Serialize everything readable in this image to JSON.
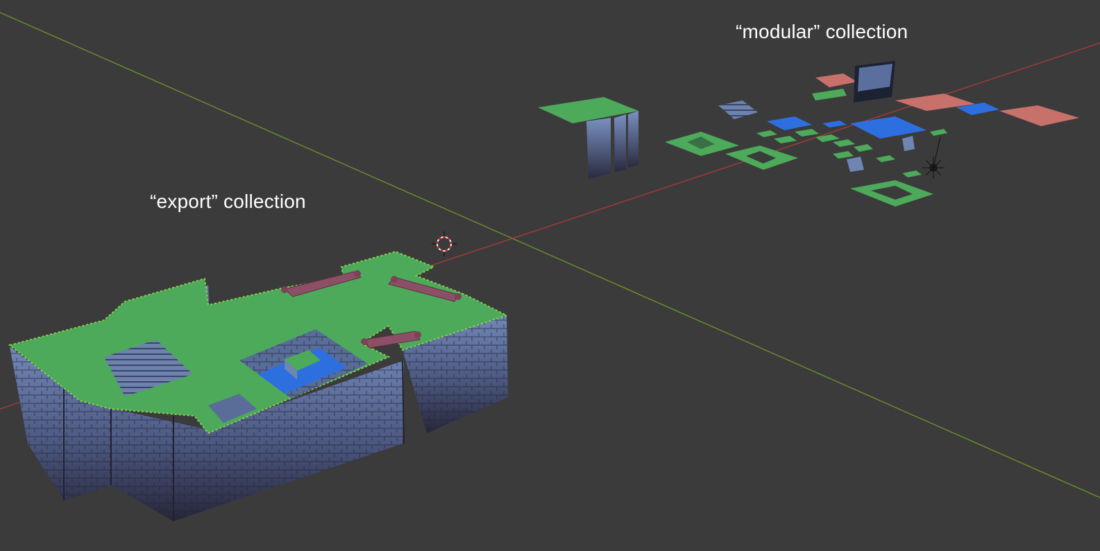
{
  "viewport": {
    "background": "#3b3b3b",
    "axis_x_color": "#b33a3a",
    "axis_y_color": "#6b8a2e",
    "cursor_icon": "3d-cursor-icon",
    "light_icon": "light-object-icon"
  },
  "labels": {
    "modular": "“modular” collection",
    "export": "“export” collection"
  },
  "palette": {
    "grass": "#4caa5a",
    "grass_dark": "#3f8f4c",
    "stone": "#6f86b3",
    "stone_dark": "#2b2a3a",
    "water": "#2e6fe0",
    "bridge": "#8c4f66",
    "brick": "#c8716a"
  }
}
